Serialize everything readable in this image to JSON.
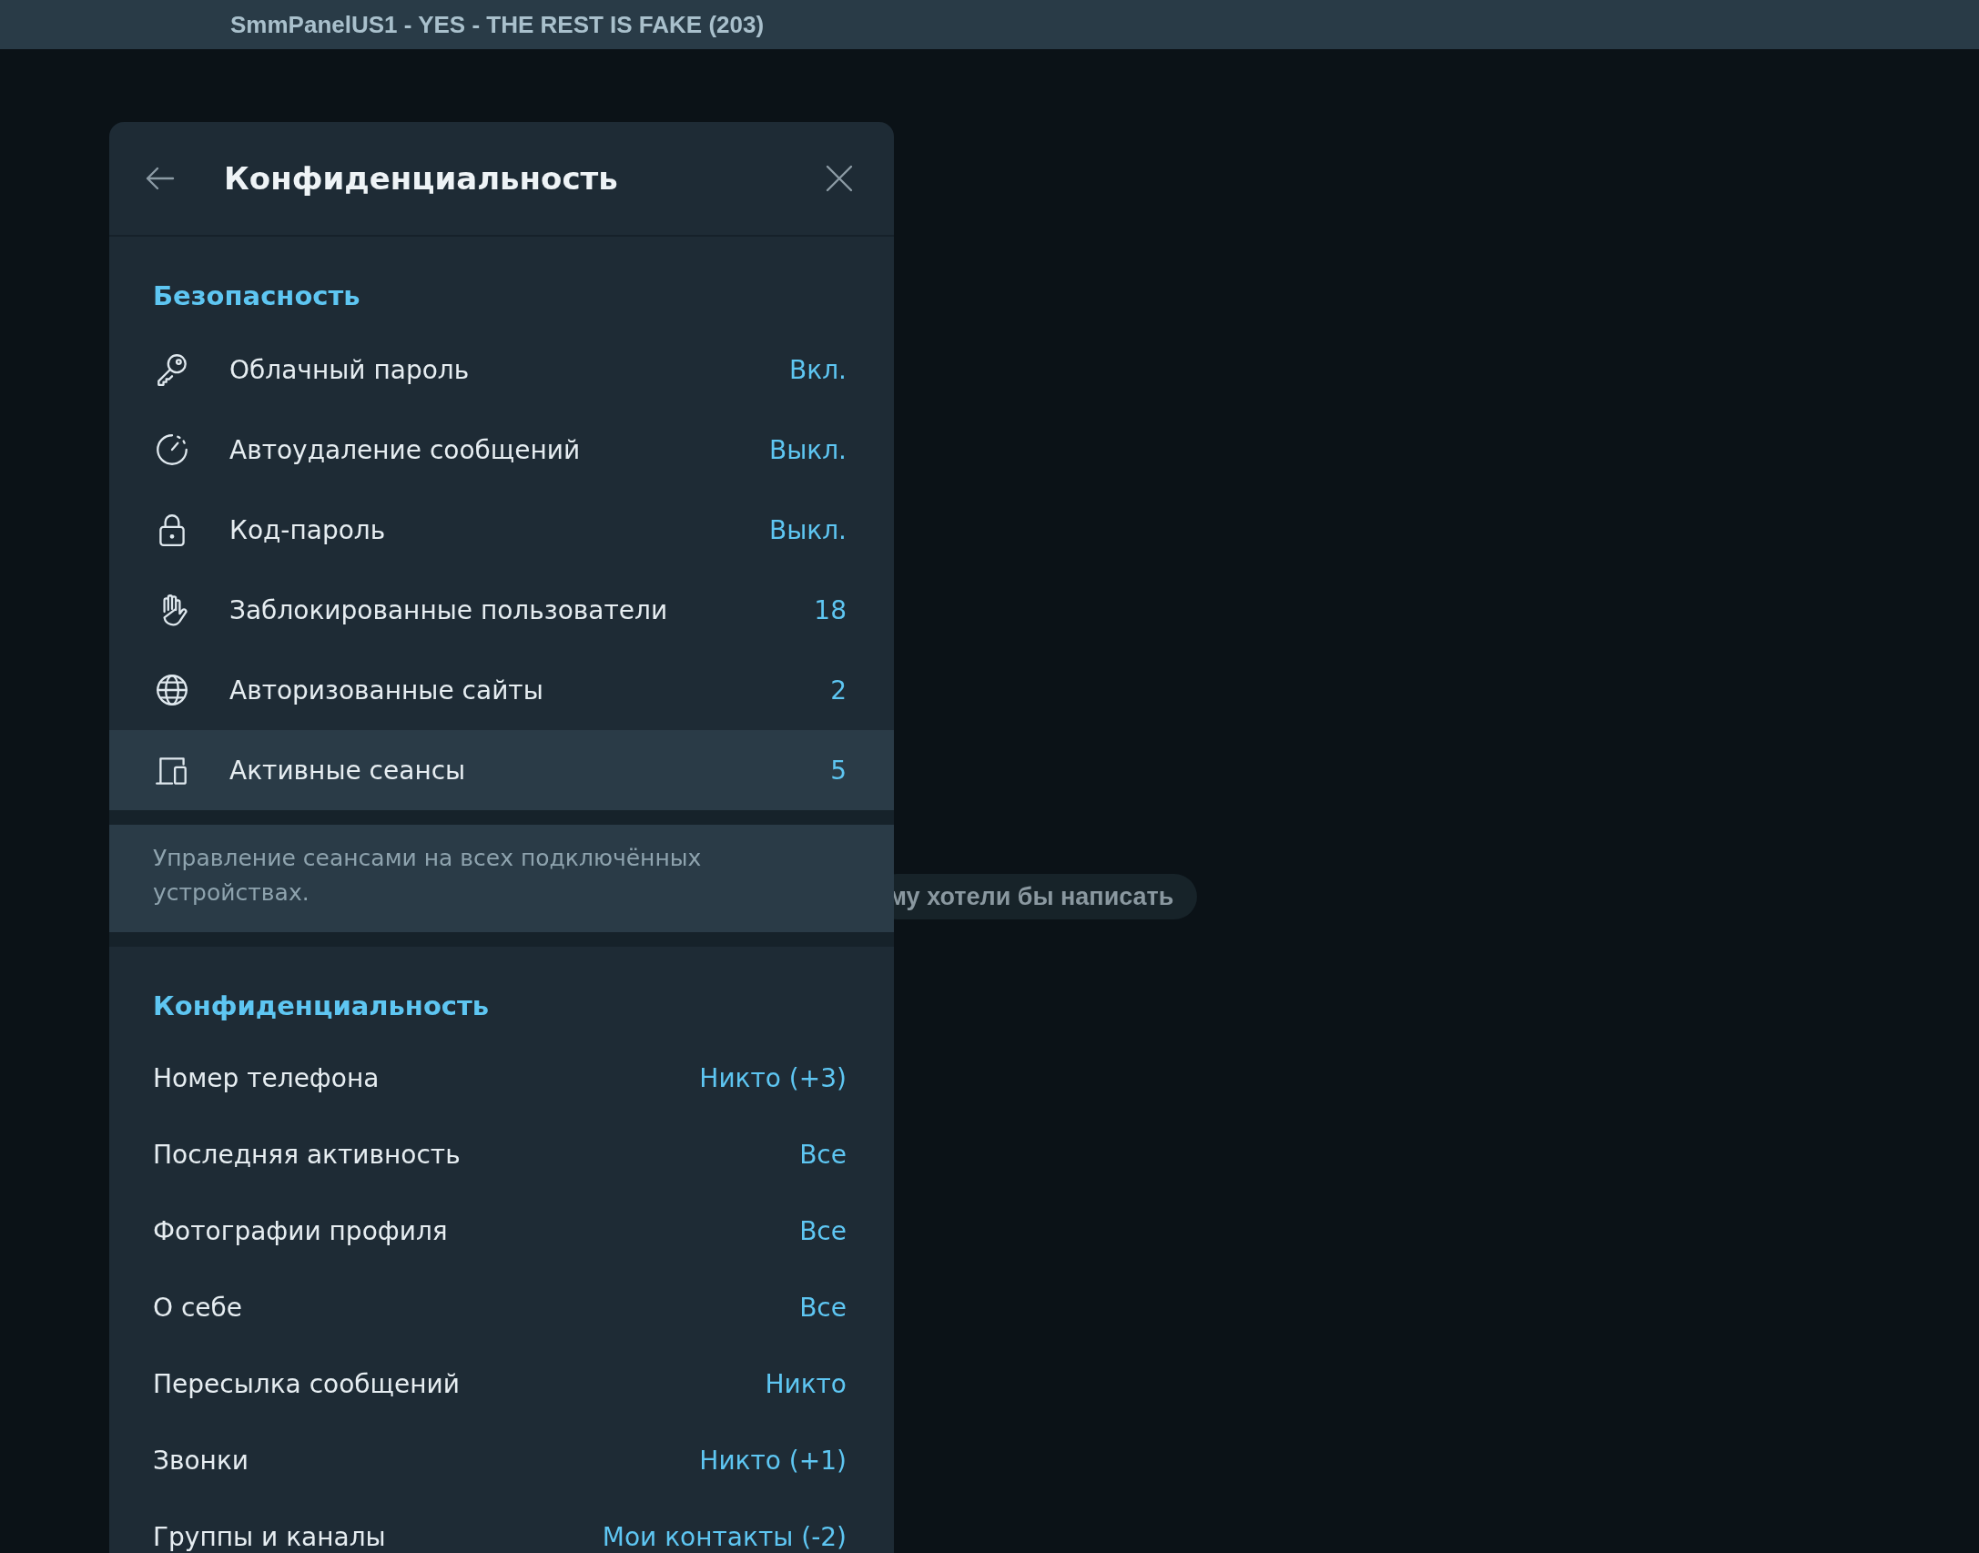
{
  "window": {
    "title": "SmmPanelUS1 - YES - THE REST IS FAKE (203)"
  },
  "background_chat": {
    "hint": "му хотели бы написать"
  },
  "panel": {
    "title": "Конфиденциальность",
    "security": {
      "heading": "Безопасность",
      "items": [
        {
          "label": "Облачный пароль",
          "value": "Вкл.",
          "selected": false
        },
        {
          "label": "Автоудаление сообщений",
          "value": "Выкл.",
          "selected": false
        },
        {
          "label": "Код-пароль",
          "value": "Выкл.",
          "selected": false
        },
        {
          "label": "Заблокированные пользователи",
          "value": "18",
          "selected": false
        },
        {
          "label": "Авторизованные сайты",
          "value": "2",
          "selected": false
        },
        {
          "label": "Активные сеансы",
          "value": "5",
          "selected": true
        }
      ],
      "note": "Управление сеансами на всех подключённых устройствах."
    },
    "privacy": {
      "heading": "Конфиденциальность",
      "items": [
        {
          "label": "Номер телефона",
          "value": "Никто (+3)"
        },
        {
          "label": "Последняя активность",
          "value": "Все"
        },
        {
          "label": "Фотографии профиля",
          "value": "Все"
        },
        {
          "label": "О себе",
          "value": "Все"
        },
        {
          "label": "Пересылка сообщений",
          "value": "Никто"
        },
        {
          "label": "Звонки",
          "value": "Никто (+1)"
        },
        {
          "label": "Группы и каналы",
          "value": "Мои контакты (-2)"
        }
      ]
    }
  }
}
